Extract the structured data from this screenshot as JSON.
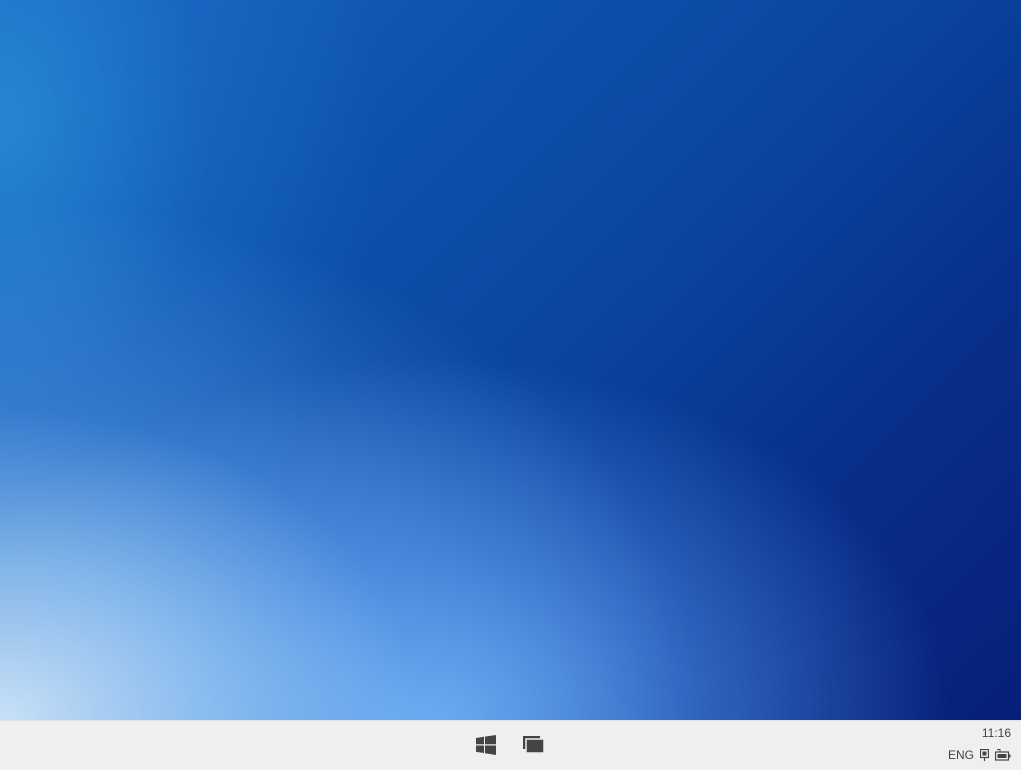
{
  "desktop": {
    "wallpaper": "blue-gradient",
    "colors": {
      "deep_blue": "#071f78",
      "mid_blue": "#0c52ad",
      "light_blue": "#a5d2fa",
      "pale_blue": "#d2e8fa"
    }
  },
  "taskbar": {
    "background": "#efefef",
    "start_icon": "windows-logo-icon",
    "task_view_icon": "task-view-icon",
    "clock": "11:16",
    "language": "ENG",
    "tray_icons": [
      "network-icon",
      "battery-icon"
    ]
  }
}
